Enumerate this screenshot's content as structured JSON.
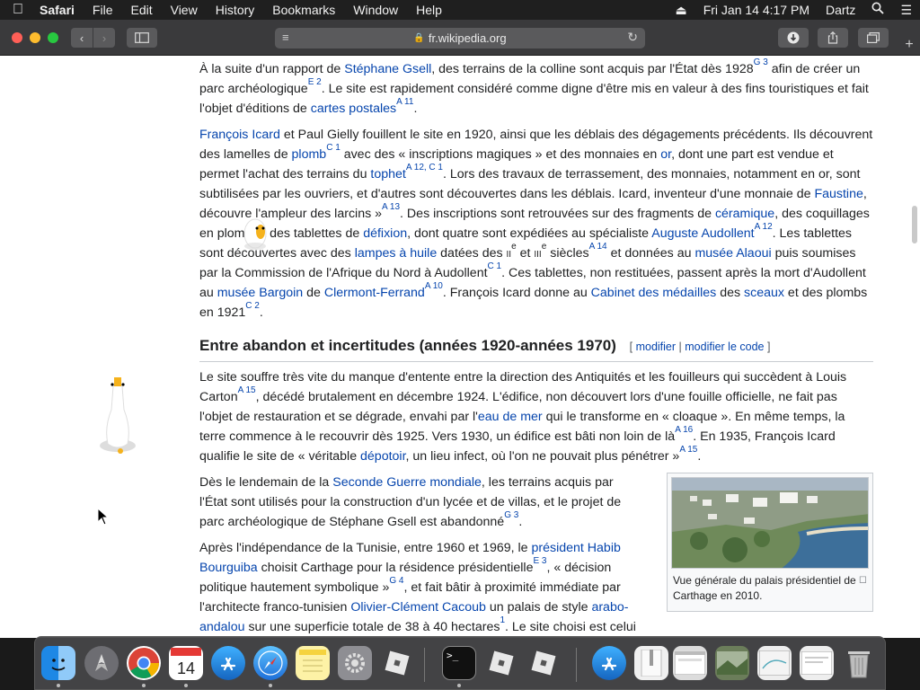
{
  "menubar": {
    "app": "Safari",
    "items": [
      "File",
      "Edit",
      "View",
      "History",
      "Bookmarks",
      "Window",
      "Help"
    ],
    "datetime": "Fri Jan 14  4:17 PM",
    "user": "Dartz"
  },
  "toolbar": {
    "url": "fr.wikipedia.org"
  },
  "article": {
    "p1": {
      "t1": "À la suite d'un rapport de ",
      "l1": "Stéphane Gsell",
      "t2": ", des terrains de la colline sont acquis par l'État dès 1928",
      "s1": "G 3",
      "t3": " afin de créer un parc archéologique",
      "s2": "E 2",
      "t4": ". Le site est rapidement considéré comme digne d'être mis en valeur à des fins touristiques et fait l'objet d'éditions de ",
      "l2": "cartes postales",
      "s3": "A 11",
      "t5": "."
    },
    "p2": {
      "l1": "François Icard",
      "t1": " et Paul Gielly fouillent le site en 1920, ainsi que les déblais des dégagements précédents. Ils découvrent des lamelles de ",
      "l2": "plomb",
      "s1": "C 1",
      "t2": " avec des « inscriptions magiques » et des monnaies en ",
      "l3": "or",
      "t3": ", dont une part est vendue et permet l'achat des terrains du ",
      "l4": "tophet",
      "s2": "A 12, C 1",
      "t4": ". Lors des travaux de terrassement, des monnaies, notamment en or, sont subtilisées par les ouvriers, et d'autres sont découvertes dans les déblais. Icard, inventeur d'une monnaie de ",
      "l5": "Faustine",
      "t5": ", découvre l'ampleur des larcins »",
      "s3": "A 13",
      "t6": ". Des inscriptions sont retrouvées sur des fragments de ",
      "l6": "céramique",
      "t7": ", des coquillages en plomb et des tablettes de ",
      "l7": "défixion",
      "t8": ", dont quatre sont expédiées au spécialiste ",
      "l8": "Auguste Audollent",
      "s4": "A 12",
      "t9": ". Les tablettes sont découvertes avec des ",
      "l9": "lampes à huile",
      "t10": " datées des ",
      "c1": "ii",
      "e1": "e",
      "t11": " et ",
      "c2": "iii",
      "e2": "e",
      "t12": " siècles",
      "s5": "A 14",
      "t13": " et données au ",
      "l10": "musée Alaoui",
      "t14": " puis soumises par la Commission de l'Afrique du Nord à Audollent",
      "s6": "C 1",
      "t15": ". Ces tablettes, non restituées, passent après la mort d'Audollent au ",
      "l11": "musée Bargoin",
      "t16": " de ",
      "l12": "Clermont-Ferrand",
      "s7": "A 10",
      "t17": ". François Icard donne au ",
      "l13": "Cabinet des médailles",
      "t18": " des ",
      "l14": "sceaux",
      "t19": " et des plombs en 1921",
      "s8": "C 2",
      "t20": "."
    },
    "section_title": "Entre abandon et incertitudes (années 1920-années 1970)",
    "edit_open": "[ ",
    "edit_modifier": "modifier",
    "edit_sep": " | ",
    "edit_modifier_code": "modifier le code",
    "edit_close": " ]",
    "p3": {
      "t1": "Le site souffre très vite du manque d'entente entre la direction des Antiquités et les fouilleurs qui succèdent à Louis Carton",
      "s1": "A 15",
      "t2": ", décédé brutalement en décembre 1924. L'édifice, non découvert lors d'une fouille officielle, ne fait pas l'objet de restauration et se dégrade, envahi par l'",
      "l1": "eau de mer",
      "t3": " qui le transforme en « cloaque ». En même temps, la terre commence à le recouvrir dès 1925. Vers 1930, un édifice est bâti non loin de là",
      "s2": "A 16",
      "t4": ". En 1935, François Icard qualifie le site de « véritable ",
      "l2": "dépotoir",
      "t5": ", un lieu infect, où l'on ne pouvait plus pénétrer »",
      "s3": "A 15",
      "t6": "."
    },
    "p4": {
      "t1": "Dès le lendemain de la ",
      "l1": "Seconde Guerre mondiale",
      "t2": ", les terrains acquis par l'État sont utilisés pour la construction d'un lycée et de villas, et le projet de parc archéologique de Stéphane Gsell est abandonné",
      "s1": "G 3",
      "t3": "."
    },
    "p5": {
      "t1": "Après l'indépendance de la Tunisie, entre 1960 et 1969, le ",
      "l1": "président Habib Bourguiba",
      "t2": " choisit Carthage pour la résidence présidentielle",
      "s1": "E 3",
      "t3": ", « décision politique hautement symbolique »",
      "s2": "G 4",
      "t4": ", et fait bâtir à proximité immédiate par l'architecte franco-tunisien ",
      "l2": "Olivier-Clément Cacoub",
      "t5": " un palais de style ",
      "l3": "arabo-andalou",
      "t6": " sur une superficie totale de 38 à 40 hectares",
      "s3": "1",
      "t7": ". Le site choisi est celui"
    },
    "thumb_caption": "Vue générale du palais présidentiel de Carthage en 2010."
  },
  "icons": {
    "apple": "apple-icon",
    "airplay": "eject-icon",
    "search": "search-icon",
    "list": "list-icon",
    "back": "chevron-left-icon",
    "forward": "chevron-right-icon",
    "sidebar": "sidebar-icon",
    "download": "download-icon",
    "share": "share-icon",
    "tabs": "tabs-icon",
    "new_tab": "plus-icon"
  },
  "colors": {
    "link": "#0645ad",
    "text": "#202122",
    "toolbar": "#3a3a3c",
    "menubar": "#1f1f1f"
  }
}
